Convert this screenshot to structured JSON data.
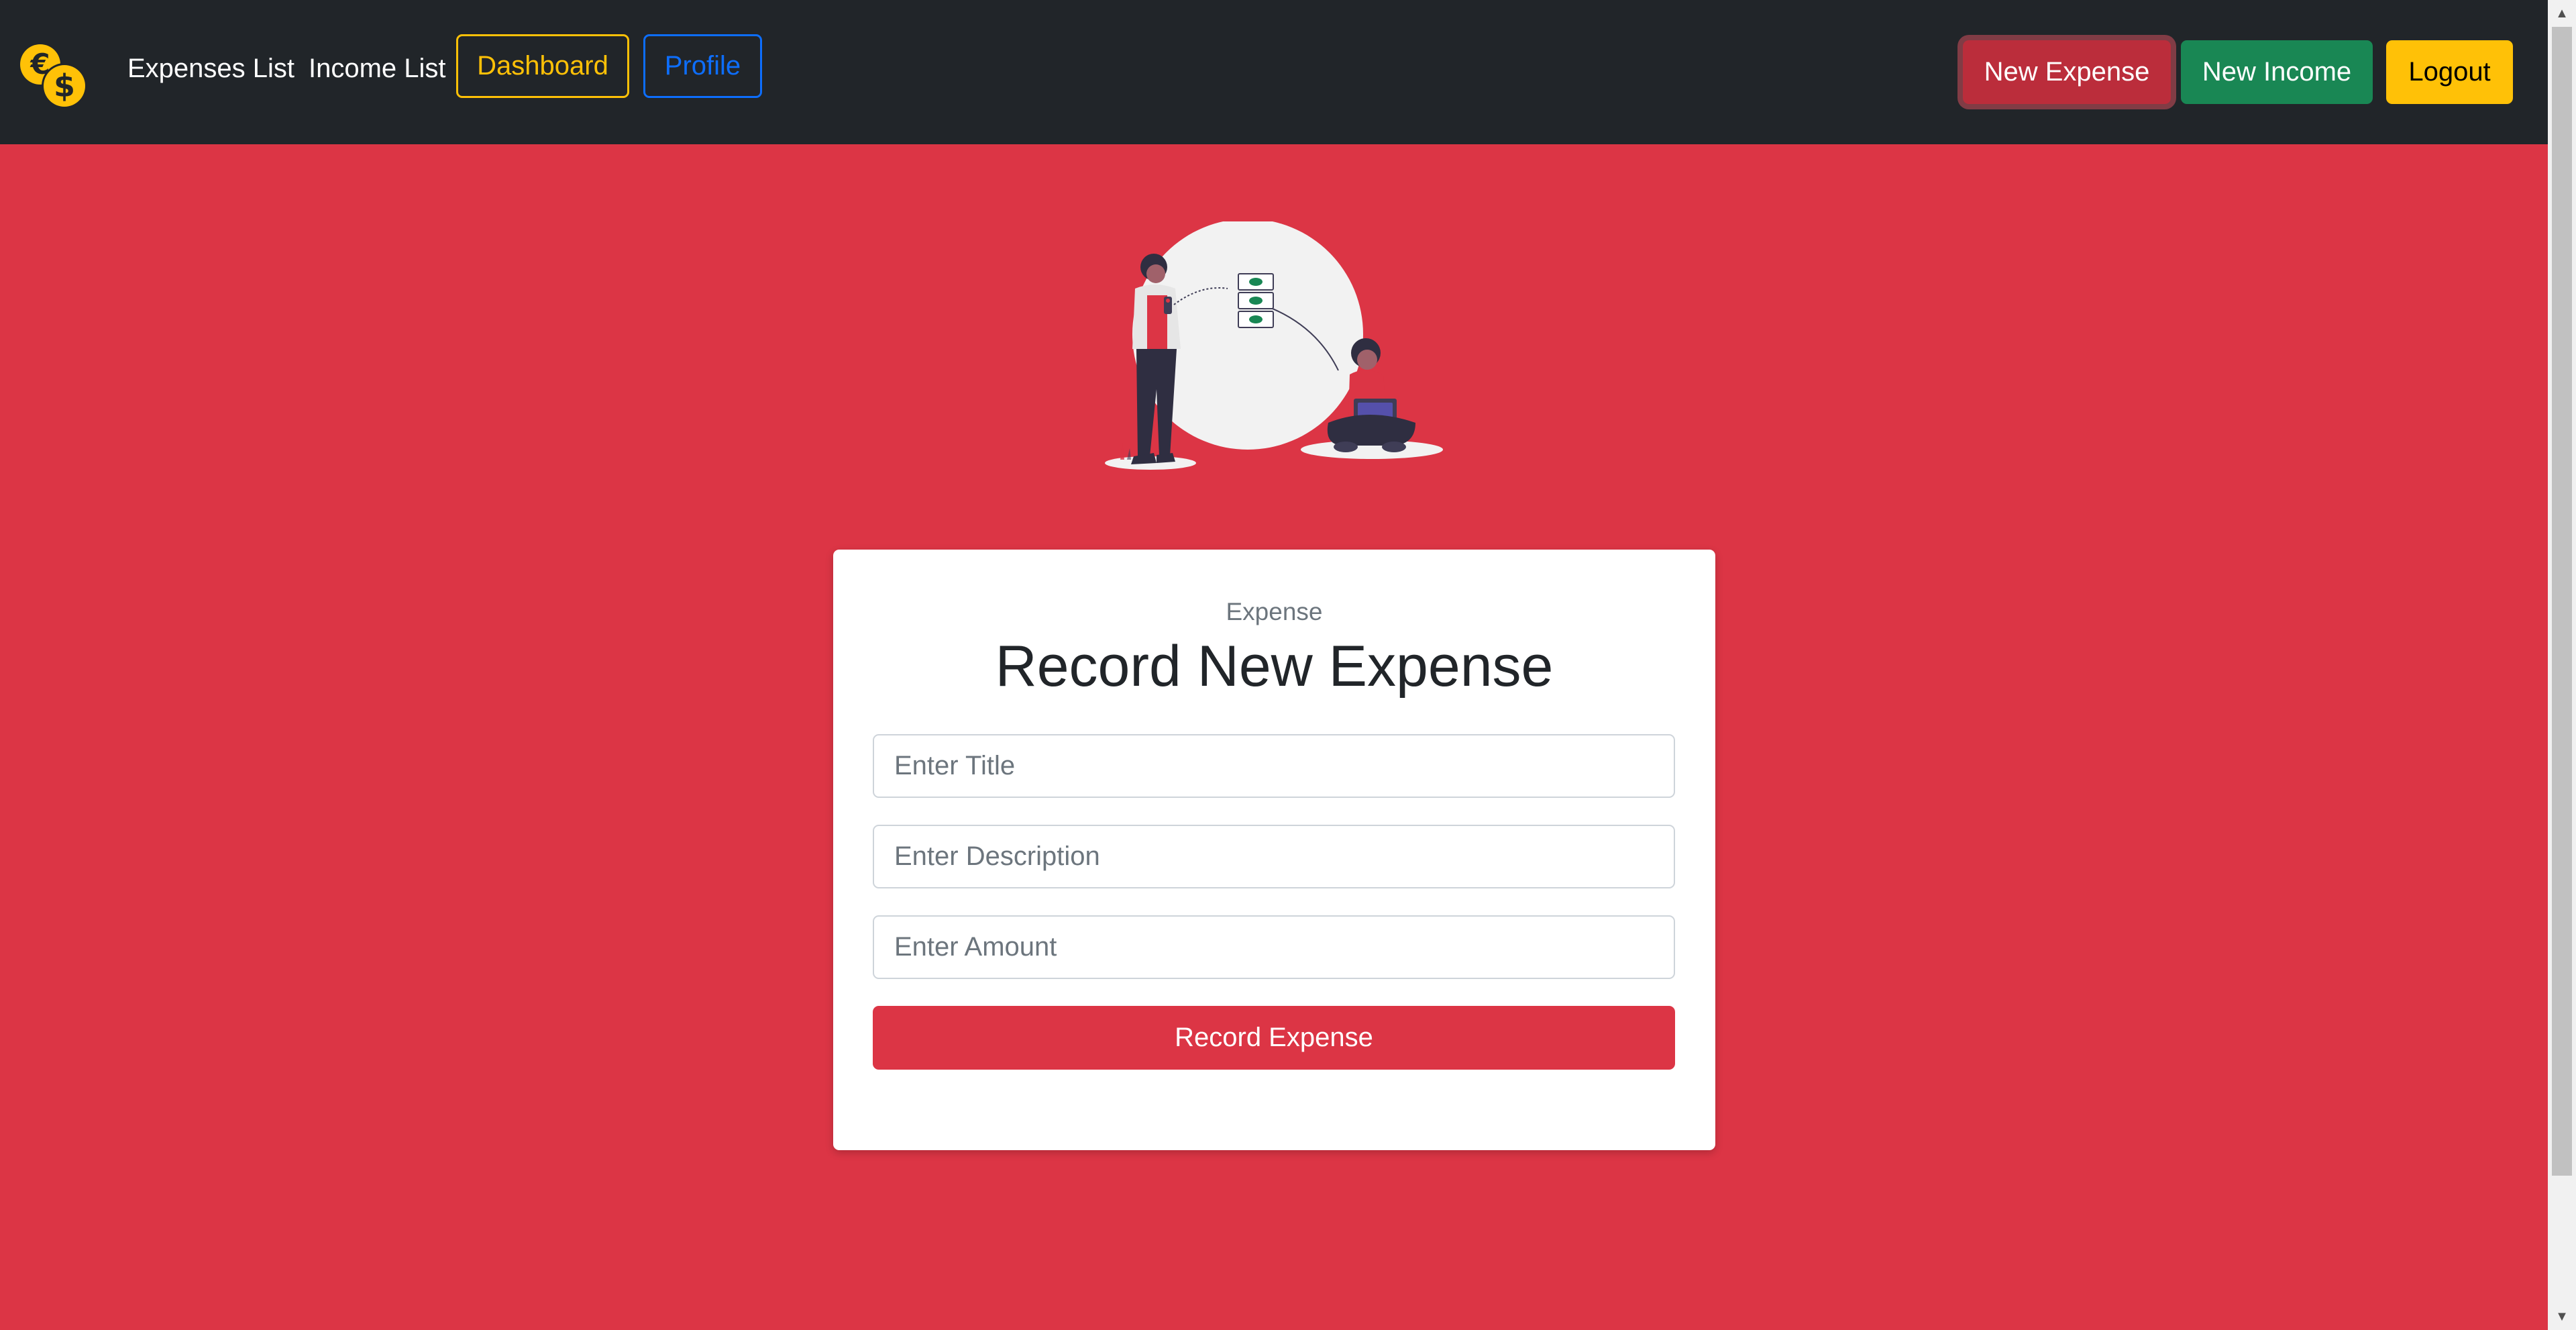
{
  "nav": {
    "logo": "euro-dollar-coins-icon",
    "links": {
      "expenses": "Expenses List",
      "income": "Income List",
      "dashboard": "Dashboard",
      "profile": "Profile"
    },
    "actions": {
      "new_expense": "New Expense",
      "new_income": "New Income",
      "logout": "Logout"
    }
  },
  "hero": {
    "illustration": "people-exchanging-money-illustration"
  },
  "form": {
    "kicker": "Expense",
    "title": "Record New Expense",
    "fields": {
      "title_placeholder": "Enter Title",
      "description_placeholder": "Enter Description",
      "amount_placeholder": "Enter Amount"
    },
    "submit_label": "Record Expense"
  },
  "colors": {
    "page_background": "#dc3545",
    "navbar": "#212529",
    "warning": "#ffc107",
    "primary": "#0d6efd",
    "danger": "#dc3545",
    "success": "#198754"
  }
}
